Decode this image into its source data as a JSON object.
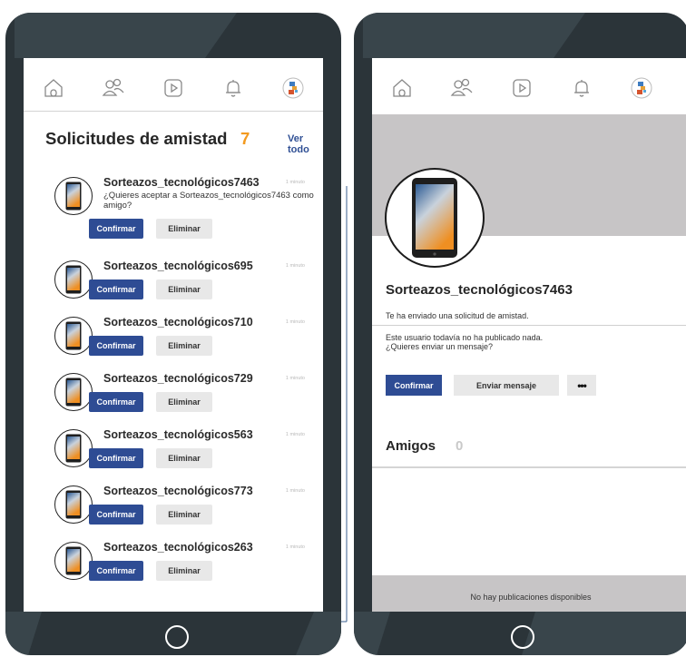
{
  "left_phone": {
    "nav": {
      "icons": [
        "home-icon",
        "friends-icon",
        "video-icon",
        "bell-icon",
        "profile-icon"
      ]
    },
    "requests": {
      "title": "Solicitudes de amistad",
      "count": "7",
      "see_all": "Ver todo",
      "confirm_label": "Confirmar",
      "delete_label": "Eliminar",
      "items": [
        {
          "name": "Sorteazos_tecnológicos7463",
          "time": "1 minuto",
          "question": "¿Quieres aceptar a Sorteazos_tecnológicos7463 como amigo?"
        },
        {
          "name": "Sorteazos_tecnológicos695",
          "time": "1 minuto"
        },
        {
          "name": "Sorteazos_tecnológicos710",
          "time": "1 minuto"
        },
        {
          "name": "Sorteazos_tecnológicos729",
          "time": "1 minuto"
        },
        {
          "name": "Sorteazos_tecnológicos563",
          "time": "1 minuto"
        },
        {
          "name": "Sorteazos_tecnológicos773",
          "time": "1 minuto"
        },
        {
          "name": "Sorteazos_tecnológicos263",
          "time": "1 minuto"
        }
      ]
    }
  },
  "right_phone": {
    "profile": {
      "name": "Sorteazos_tecnológicos7463",
      "request_sent": "Te ha enviado una solicitud de amistad.",
      "info_line1": "Este usuario todavía no ha publicado nada.",
      "info_line2": "¿Quieres enviar un mensaje?",
      "confirm_label": "Confirmar",
      "message_label": "Enviar mensaje",
      "more_label": "•••"
    },
    "friends": {
      "title": "Amigos",
      "count": "0"
    },
    "no_posts": "No hay publicaciones disponibles"
  },
  "colors": {
    "phone_body": "#2b3439",
    "accent_blue": "#2e4c94",
    "count_orange": "#f39a1f",
    "cover_gray": "#c7c5c6"
  }
}
